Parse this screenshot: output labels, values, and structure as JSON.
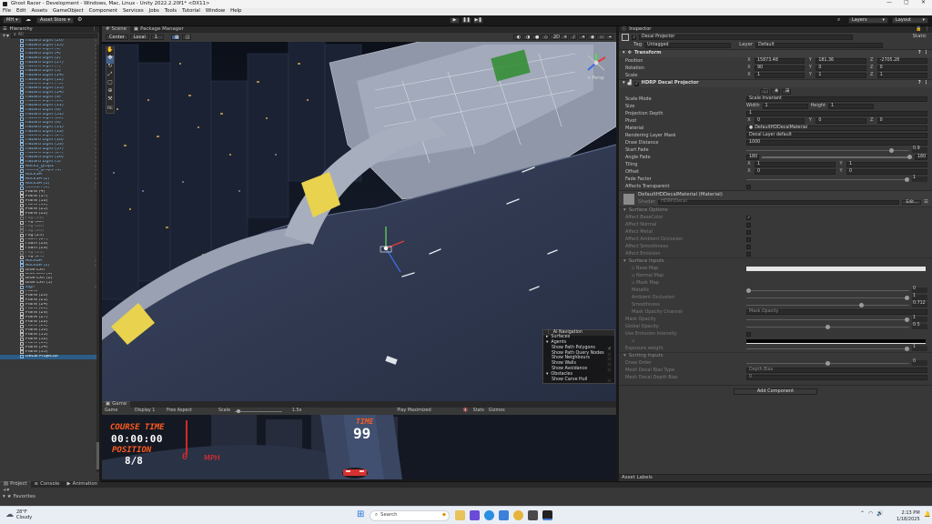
{
  "window": {
    "title": "Ghost Racer - Development - Windows, Mac, Linux - Unity 2022.2.20f1* <DX11>",
    "controls": [
      "—",
      "▢",
      "✕"
    ]
  },
  "menu": [
    "File",
    "Edit",
    "Assets",
    "GameObject",
    "Component",
    "Services",
    "Jobs",
    "Tools",
    "Tutorial",
    "Window",
    "Help"
  ],
  "toolbar": {
    "account": "MH",
    "asset_store": "Asset Store",
    "layers": "Layers",
    "layout": "Layout"
  },
  "hierarchy": {
    "title": "Hierarchy",
    "search_placeholder": "All",
    "rows": [
      {
        "name": "Hazard Light (26)",
        "style": "blue"
      },
      {
        "name": "Hazard Light (15)",
        "style": "blue"
      },
      {
        "name": "Hazard Light (1)",
        "style": "blue"
      },
      {
        "name": "Hazard Light (4)",
        "style": "blue"
      },
      {
        "name": "Hazard Light (2)",
        "style": "blue"
      },
      {
        "name": "Hazard Light (17)",
        "style": "blue"
      },
      {
        "name": "Hazard Light (7)",
        "style": "blue"
      },
      {
        "name": "Hazard Light (3)",
        "style": "blue"
      },
      {
        "name": "Hazard Light (14)",
        "style": "blue"
      },
      {
        "name": "Hazard Light (12)",
        "style": "blue"
      },
      {
        "name": "Hazard Light (40)",
        "style": "blue"
      },
      {
        "name": "Hazard Light (13)",
        "style": "blue"
      },
      {
        "name": "Hazard Light (14)",
        "style": "blue"
      },
      {
        "name": "Hazard Light (9)",
        "style": "blue"
      },
      {
        "name": "Hazard Light (10)",
        "style": "blue"
      },
      {
        "name": "Hazard Light (11)",
        "style": "blue"
      },
      {
        "name": "Hazard Light (8)",
        "style": "blue"
      },
      {
        "name": "Hazard Light (31)",
        "style": "blue"
      },
      {
        "name": "Hazard Light (22)",
        "style": "blue"
      },
      {
        "name": "Hazard Light (6)",
        "style": "blue"
      },
      {
        "name": "Hazard Light (11)",
        "style": "blue"
      },
      {
        "name": "Hazard Light (19)",
        "style": "blue"
      },
      {
        "name": "Hazard Light (27)",
        "style": "blue"
      },
      {
        "name": "Hazard Light (18)",
        "style": "blue"
      },
      {
        "name": "Hazard Light (39)",
        "style": "blue"
      },
      {
        "name": "Hazard Light (37)",
        "style": "blue"
      },
      {
        "name": "Hazard Light (27)",
        "style": "blue"
      },
      {
        "name": "Hazard Light (16)",
        "style": "blue"
      },
      {
        "name": "Hazard Light (5)",
        "style": "blue"
      },
      {
        "name": "Rock1_grup1",
        "style": "blue"
      },
      {
        "name": "Rock1_grup1 (1)",
        "style": "blue"
      },
      {
        "name": "RockSA",
        "style": "blue"
      },
      {
        "name": "RockSA (2)",
        "style": "blue"
      },
      {
        "name": "RockSA (3)",
        "style": "blue"
      },
      {
        "name": "RockSA (1)",
        "style": "blue"
      },
      {
        "name": "Plane (4)",
        "style": "white"
      },
      {
        "name": "Plane (17)",
        "style": "white"
      },
      {
        "name": "Plane (18)",
        "style": "white"
      },
      {
        "name": "Plane (19)",
        "style": "white"
      },
      {
        "name": "Plane (23)",
        "style": "white"
      },
      {
        "name": "Plane (22)",
        "style": "white"
      },
      {
        "name": "Fog (19)",
        "style": "dim"
      },
      {
        "name": "Fog (22)",
        "style": "white"
      },
      {
        "name": "Fog (26)",
        "style": "dim"
      },
      {
        "name": "Fog (20)",
        "style": "dim"
      },
      {
        "name": "Fog (25)",
        "style": "white"
      },
      {
        "name": "Foam (27)",
        "style": "white"
      },
      {
        "name": "Foam (28)",
        "style": "white"
      },
      {
        "name": "Foam (29)",
        "style": "white"
      },
      {
        "name": "Fog (23)",
        "style": "dim"
      },
      {
        "name": "Fog (24)",
        "style": "white"
      },
      {
        "name": "RockBA",
        "style": "blue"
      },
      {
        "name": "RockBA (1)",
        "style": "blue"
      },
      {
        "name": "Blue Exit",
        "style": "white"
      },
      {
        "name": "Blue Exit (1)",
        "style": "white"
      },
      {
        "name": "Blue Exit (2)",
        "style": "white"
      },
      {
        "name": "Blue Exit (3)",
        "style": "white"
      },
      {
        "name": "sign",
        "style": "blue"
      },
      {
        "name": "Plane",
        "style": "white"
      },
      {
        "name": "Plane (20)",
        "style": "white"
      },
      {
        "name": "Plane (21)",
        "style": "white"
      },
      {
        "name": "Plane (24)",
        "style": "white"
      },
      {
        "name": "Plane (25)",
        "style": "white"
      },
      {
        "name": "Plane (26)",
        "style": "white"
      },
      {
        "name": "Plane (27)",
        "style": "white"
      },
      {
        "name": "Plane (28)",
        "style": "white"
      },
      {
        "name": "Plane (29)",
        "style": "white"
      },
      {
        "name": "Plane (30)",
        "style": "white"
      },
      {
        "name": "Plane (31)",
        "style": "white"
      },
      {
        "name": "Plane (32)",
        "style": "white"
      },
      {
        "name": "Plane (33)",
        "style": "white"
      },
      {
        "name": "Plane (34)",
        "style": "white"
      },
      {
        "name": "Plane (35)",
        "style": "white"
      },
      {
        "name": "Decal Projector",
        "style": "sel"
      }
    ]
  },
  "scene": {
    "tabs": [
      "Scene",
      "Package Manager"
    ],
    "pivot": "Center",
    "space": "Local",
    "snap": "1",
    "persp_label": "< Persp",
    "mode_2d": "2D",
    "tool_label": "RE",
    "nav_overlay": {
      "title": "AI Navigation",
      "surfaces": "Surfaces",
      "agents": "Agents",
      "agent_items": [
        "Show Path Polygons",
        "Show Path Query Nodes",
        "Show Neighbours",
        "Show Walls",
        "Show Avoidance"
      ],
      "obstacles": "Obstacles",
      "obstacle_items": [
        "Show Carve Hull"
      ]
    }
  },
  "game": {
    "tab": "Game",
    "mode": "Game",
    "display": "Display 1",
    "aspect": "Free Aspect",
    "scale_label": "Scale",
    "scale_value": "1.5x",
    "play_mode": "Play Maximized",
    "stats": "Stats",
    "gizmos": "Gizmos",
    "hud": {
      "course_time_label": "COURSE TIME",
      "course_time_value": "00:00:00",
      "position_label": "POSITION",
      "position_value": "8/8",
      "speed_value": "0",
      "speed_unit": "MPH",
      "time_label": "TIME",
      "time_value": "99"
    }
  },
  "inspector": {
    "title": "Inspector",
    "object_name": "Decal Projector",
    "static_label": "Static",
    "tag_label": "Tag",
    "tag_value": "Untagged",
    "layer_label": "Layer",
    "layer_value": "Default",
    "transform": {
      "title": "Transform",
      "position_label": "Position",
      "position": {
        "x": "15873.48",
        "y": "181.36",
        "z": "-2705.28"
      },
      "rotation_label": "Rotation",
      "rotation": {
        "x": "90",
        "y": "0",
        "z": "0"
      },
      "scale_label": "Scale",
      "scale": {
        "x": "1",
        "y": "1",
        "z": "1"
      }
    },
    "decal": {
      "title": "HDRP Decal Projector",
      "scale_mode_label": "Scale Mode",
      "scale_mode_value": "Scale Invariant",
      "size_label": "Size",
      "width_label": "Width",
      "width_value": "1",
      "height_label": "Height",
      "height_value": "1",
      "projection_depth_label": "Projection Depth",
      "projection_depth_value": "1",
      "pivot_label": "Pivot",
      "pivot": {
        "x": "0",
        "y": "0",
        "z": "0"
      },
      "material_label": "Material",
      "material_value": "DefaultHDDecalMaterial",
      "rendering_layer_label": "Rendering Layer Mask",
      "rendering_layer_value": "Decal Layer default",
      "draw_distance_label": "Draw Distance",
      "draw_distance_value": "1000",
      "start_fade_label": "Start Fade",
      "start_fade_value": "0.9",
      "start_fade_level": 0.9,
      "angle_fade_label": "Angle Fade",
      "angle_fade_min": "180",
      "angle_fade_max": "180",
      "tiling_label": "Tiling",
      "tiling": {
        "x": "1",
        "y": "1"
      },
      "offset_label": "Offset",
      "offset": {
        "x": "0",
        "y": "0"
      },
      "fade_factor_label": "Fade Factor",
      "fade_factor_value": "1",
      "fade_factor_level": 1.0,
      "affects_transparent_label": "Affects Transparent"
    },
    "material": {
      "title": "DefaultHDDecalMaterial (Material)",
      "shader_label": "Shader",
      "shader_value": "HDRP/Decal",
      "edit_label": "Edit..."
    },
    "surface_options": {
      "title": "Surface Options",
      "items": [
        "Affect BaseColor",
        "Affect Normal",
        "Affect Metal",
        "Affect Ambient Occlusion",
        "Affect Smoothness",
        "Affect Emission"
      ]
    },
    "surface_inputs": {
      "title": "Surface Inputs",
      "base_map": "Base Map",
      "normal_map": "Normal Map",
      "mask_map": "Mask Map",
      "metallic_label": "Metallic",
      "metallic_value": "0",
      "metallic_level": 0,
      "ao_label": "Ambient Occlusion",
      "ao_value": "1",
      "ao_level": 1,
      "smoothness_label": "Smoothness",
      "smoothness_value": "0.712",
      "smoothness_level": 0.712,
      "mask_opacity_channel_label": "Mask Opacity Channel",
      "mask_opacity_channel_value": "Mask Opacity",
      "mask_opacity_label": "Mask Opacity",
      "mask_opacity_value": "1",
      "mask_opacity_level": 1,
      "global_opacity_label": "Global Opacity",
      "global_opacity_value": "0.5",
      "global_opacity_level": 0.5,
      "use_emission_label": "Use Emission Intensity",
      "emissive_map_label": "Emissive Map",
      "exposure_weight_label": "Exposure weight",
      "exposure_weight_value": "1",
      "exposure_weight_level": 1
    },
    "sorting_inputs": {
      "title": "Sorting Inputs",
      "draw_order_label": "Draw Order",
      "draw_order_value": "0",
      "draw_order_level": 0.5,
      "mesh_bias_type_label": "Mesh Decal Bias Type",
      "mesh_bias_type_value": "Depth Bias",
      "mesh_depth_bias_label": "Mesh Decal Depth Bias",
      "mesh_depth_bias_value": "0"
    },
    "add_component": "Add Component",
    "asset_labels": "Asset Labels"
  },
  "bottom": {
    "tabs": [
      "Project",
      "Console",
      "Animation"
    ],
    "favorites": "Favorites"
  },
  "taskbar": {
    "temperature": "28°F",
    "weather": "Cloudy",
    "search_placeholder": "Search",
    "time": "2:13 PM",
    "date": "1/18/2025"
  },
  "colors": {
    "selection": "#2c5d87",
    "hud_orange": "#ff5a1f",
    "hud_red": "#ff2b2b",
    "road": "#2b3447",
    "decal_yellow": "#e9d24d"
  }
}
